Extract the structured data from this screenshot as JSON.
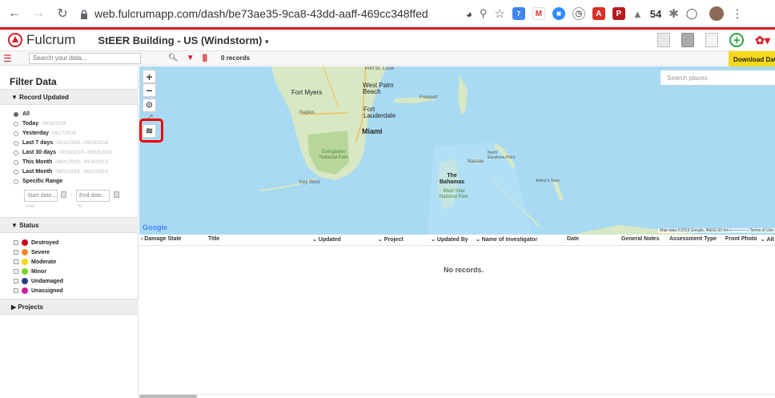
{
  "browser": {
    "url": "web.fulcrumapp.com/dash/be73ae35-9ca8-43dd-aaff-469cc348ffed",
    "badge_count": "54",
    "ext_badge": "7"
  },
  "app": {
    "logo": "Fulcrum",
    "project_title": "StEER Building - US (Windstorm)",
    "project_caret": "▾"
  },
  "toolbar": {
    "search_placeholder": "Search your data...",
    "record_count": "0 records",
    "download_label": "Download Data"
  },
  "sidebar": {
    "title": "Filter Data",
    "record_updated": {
      "header": "▼ Record Updated",
      "options": [
        {
          "label": "All",
          "date": "",
          "selected": true
        },
        {
          "label": "Today",
          "date": "09/18/2019",
          "selected": false
        },
        {
          "label": "Yesterday",
          "date": "09/17/2019",
          "selected": false
        },
        {
          "label": "Last 7 days",
          "date": "09/11/2019 - 09/18/2019",
          "selected": false
        },
        {
          "label": "Last 30 days",
          "date": "08/19/2019 - 09/18/2019",
          "selected": false
        },
        {
          "label": "This Month",
          "date": "09/01/2019 - 09/30/2019",
          "selected": false
        },
        {
          "label": "Last Month",
          "date": "08/01/2019 - 08/31/2019",
          "selected": false
        },
        {
          "label": "Specific Range",
          "date": "",
          "selected": false
        }
      ],
      "start_placeholder": "Start date...",
      "end_placeholder": "End date...",
      "range_sep": "-",
      "from_label": "From",
      "to_label": "To"
    },
    "status": {
      "header": "▼ Status",
      "items": [
        {
          "label": "Destroyed",
          "color": "#d0021b"
        },
        {
          "label": "Severe",
          "color": "#f5862a"
        },
        {
          "label": "Moderate",
          "color": "#f8d40b"
        },
        {
          "label": "Minor",
          "color": "#7ed321"
        },
        {
          "label": "Undamaged",
          "color": "#2c3e8f"
        },
        {
          "label": "Unassigned",
          "color": "#d41ba1"
        }
      ]
    },
    "projects": {
      "header": "▶ Projects"
    }
  },
  "map": {
    "search_placeholder": "Search places",
    "google": "Google",
    "attribution": "Map data ©2019 Google, INEGI   50 km ⊢———⊣   Terms of Use",
    "labels": {
      "port_st_lucie": "Port St. Lucie",
      "west_palm": "West Palm\nBeach",
      "fort_myers": "Fort Myers",
      "naples": "Naples",
      "fort_lauderdale": "Fort\nLauderdale",
      "miami": "Miami",
      "everglades": "Everglades\nNational Park",
      "key_west": "Key West",
      "freeport": "Freeport",
      "nassau": "Nassau",
      "north_eleuthera": "North\nEleuthera Point",
      "the_bahamas": "The\nBahamas",
      "west_side": "West Side\nNational Park",
      "arthurs_town": "Arthur's Town"
    }
  },
  "grid": {
    "columns": [
      "› Damage State",
      "Title",
      "⌄ Updated",
      "⌄ Project",
      "⌄ Updated By",
      "⌄ Name of Investigator",
      "Date",
      "General Notes",
      "Assessment Type",
      "Front Photo",
      "⌄ Alt"
    ],
    "empty_message": "No records."
  }
}
